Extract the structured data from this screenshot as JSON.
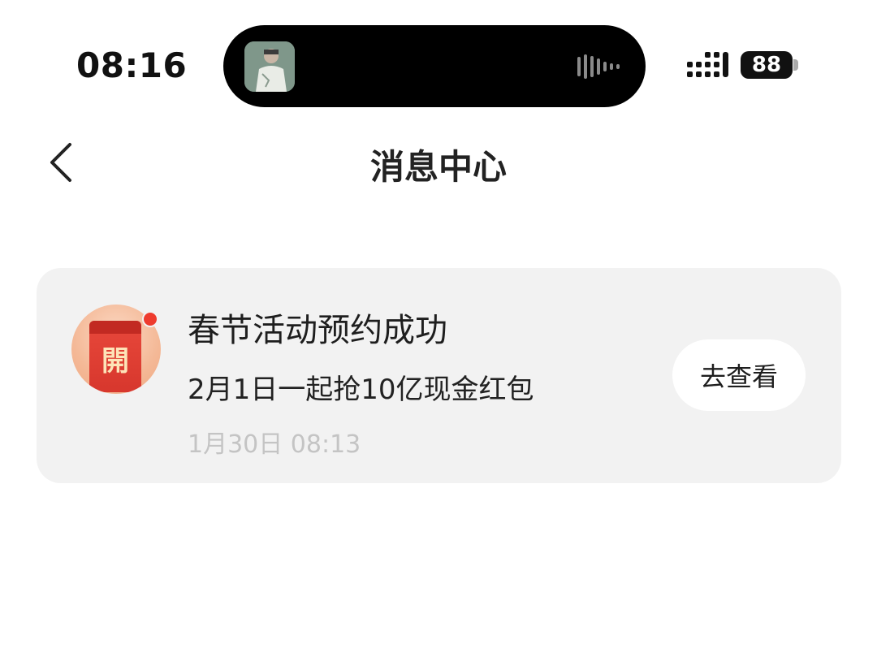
{
  "status_bar": {
    "time": "08:16",
    "battery_level": "88",
    "signal_icon": "signal-bars-icon",
    "island_icons": [
      "album-art-thumbnail",
      "audio-waveform-icon"
    ]
  },
  "nav": {
    "back_icon": "chevron-left-icon",
    "title": "消息中心"
  },
  "messages": [
    {
      "icon": "red-envelope-icon",
      "icon_char": "開",
      "unread": true,
      "title": "春节活动预约成功",
      "body": "2月1日一起抢10亿现金红包",
      "time": "1月30日 08:13",
      "action_label": "去查看"
    }
  ],
  "colors": {
    "card_bg": "#f2f2f2",
    "envelope_red": "#e8483b",
    "unread_dot": "#ee3b2e",
    "timestamp_gray": "#c4c4c4"
  }
}
